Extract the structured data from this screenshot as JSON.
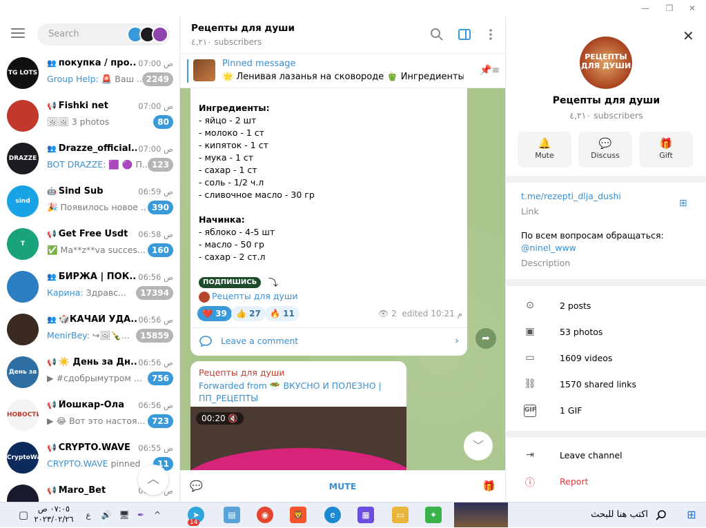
{
  "search": {
    "placeholder": "Search"
  },
  "chats": [
    {
      "name": "покупка / про...",
      "time": "07:00 ص",
      "preview_hl": "Group Help:",
      "preview": " 🚨 Ваш ...",
      "badge": "2249",
      "muted": true,
      "icon": "group-icon",
      "ava_text": "TG LOTS",
      "ava_color": "#111111"
    },
    {
      "name": "Fishki net",
      "time": "07:00 ص",
      "preview_hl": "",
      "preview": "🖼🖼 3 photos",
      "badge": "80",
      "muted": false,
      "icon": "channel-icon",
      "ava_text": "",
      "ava_color": "#c0392b"
    },
    {
      "name": "Drazze_official...",
      "time": "07:00 ص",
      "preview_hl": "BOT DRAZZE:",
      "preview": " 🟪 🟣 П...",
      "badge": "123",
      "muted": true,
      "icon": "group-icon",
      "ava_text": "DRAZZE",
      "ava_color": "#1b1b22"
    },
    {
      "name": "Sind Sub",
      "time": "06:59 ص",
      "preview_hl": "",
      "preview": "🎉 Появилось новое ...",
      "badge": "390",
      "muted": false,
      "icon": "bot-icon",
      "ava_text": "sind",
      "ava_color": "#18a3e6"
    },
    {
      "name": "Get Free Usdt",
      "time": "06:58 ص",
      "preview_hl": "",
      "preview": "✅ Ma**z**va succes...",
      "badge": "160",
      "muted": false,
      "icon": "channel-icon",
      "ava_text": "T",
      "ava_color": "#1aa37a"
    },
    {
      "name": "БИРЖА | ПОК...",
      "time": "06:56 ص",
      "preview_hl": "Карина:",
      "preview": " Здравс...",
      "badge": "17394",
      "muted": true,
      "icon": "group-icon",
      "ava_text": "",
      "ava_color": "#2b7fc2"
    },
    {
      "name": "🎲КАЧАЙ УДА...",
      "time": "06:56 ص",
      "preview_hl": "MenirBey:",
      "preview": " ↪🖼🍾...",
      "badge": "15859",
      "muted": true,
      "icon": "group-icon",
      "ava_text": "",
      "ava_color": "#3b2a20"
    },
    {
      "name": "☀️ День за Дн...",
      "time": "06:56 ص",
      "preview_hl": "",
      "preview": "▶ #сдобрымутром ...",
      "badge": "756",
      "muted": false,
      "icon": "channel-icon",
      "ava_text": "День за днем",
      "ava_color": "#2e6fa3"
    },
    {
      "name": "Йошкар-Ола",
      "time": "06:56 ص",
      "preview_hl": "",
      "preview": "▶ 😂 Вот это настоя...",
      "badge": "723",
      "muted": false,
      "icon": "channel-icon",
      "ava_text": "НОВОСТИ",
      "ava_color": "#f4f4f4"
    },
    {
      "name": "CRYPTO.WAVE",
      "time": "06:55 ص",
      "preview_hl": "CRYPTO.WAVE",
      "preview": " pinned",
      "badge": "11",
      "muted": false,
      "icon": "channel-icon",
      "ava_text": "CryptoWave",
      "ava_color": "#0d2a5c"
    },
    {
      "name": "Maro_Bet",
      "time": "06:55 ص",
      "preview_hl": "",
      "preview": "",
      "badge": "",
      "muted": false,
      "icon": "channel-icon",
      "ava_text": "",
      "ava_color": "#1a1a2e"
    }
  ],
  "header": {
    "title": "Рецепты для души",
    "subscribers": "٤,٢١٠ subscribers"
  },
  "pinned": {
    "label": "Pinned message",
    "text": "🌟 Ленивая лазанья на сковороде 🫑 Ингредиенты: ..."
  },
  "message1": {
    "ingredients_title": "Ингредиенты:",
    "ingredients": "- яйцо - 2 шт\n- молоко - 1 ст\n- кипяток - 1 ст\n- мука - 1 ст\n- сахар - 1 ст\n- соль - 1/2 ч.л\n- сливочное масло - 30 гр",
    "filling_title": "Начинка:",
    "filling": "- яблоко - 4-5 шт\n- масло - 50 гр\n- сахар - 2 ст.л",
    "subscribe_label": "ПОДПИШИСЬ",
    "channel_link": "Рецепты для души",
    "reactions": [
      {
        "emoji": "❤️",
        "count": "39",
        "selected": true
      },
      {
        "emoji": "👍",
        "count": "27",
        "selected": false
      },
      {
        "emoji": "🔥",
        "count": "11",
        "selected": false
      }
    ],
    "views": "2",
    "edited": "edited 10:21 م",
    "comment_label": "Leave a comment"
  },
  "message2": {
    "sender": "Рецепты для души",
    "forwarded": "Forwarded from 🥗 ВКУСНО И ПОЛЕЗНО | ПП_РЕЦЕПТЫ",
    "video_time": "00:20"
  },
  "footer": {
    "mute_label": "MUTE"
  },
  "profile": {
    "title": "Рецепты для души",
    "subscribers": "٤,٢١٠ subscribers",
    "avatar_text": "РЕЦЕПТЫ ДЛЯ ДУШИ",
    "actions": [
      {
        "label": "Mute",
        "icon": "bell-icon"
      },
      {
        "label": "Discuss",
        "icon": "chat-bubble-icon"
      },
      {
        "label": "Gift",
        "icon": "gift-icon"
      }
    ],
    "link": "t.me/rezepti_dlja_dushi",
    "link_label": "Link",
    "description": "По всем вопросам обращаться:",
    "description_link": "@ninel_www",
    "description_label": "Description",
    "media": [
      {
        "label": "2 posts",
        "icon": "posts-icon"
      },
      {
        "label": "53 photos",
        "icon": "photo-icon"
      },
      {
        "label": "1609 videos",
        "icon": "video-icon"
      },
      {
        "label": "1570 shared links",
        "icon": "link-icon"
      },
      {
        "label": "1 GIF",
        "icon": "gif-icon"
      }
    ],
    "leave_label": "Leave channel",
    "report_label": "Report"
  },
  "taskbar": {
    "search_placeholder": "اكتب هنا للبحث",
    "time": "٠٧:٠٥ ص",
    "date": "٢٠٢٣/٠٢/٢٦",
    "lang": "ع",
    "telegram_badge": "14"
  }
}
